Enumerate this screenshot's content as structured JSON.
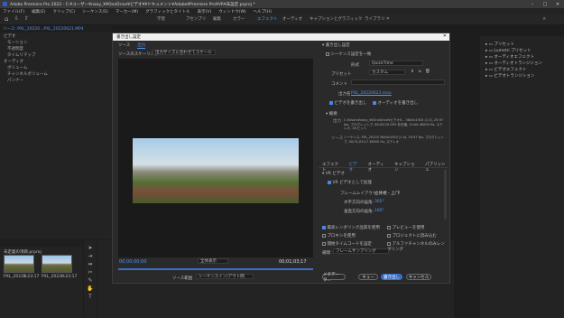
{
  "window": {
    "title": "Adobe Premiere Pro 2022 - C:¥ユーザー¥naoy_¥¥OneDrive¥ビデオ¥¥ドキュメント¥Adobe¥Premiere Pro¥VR¥未設定.prproj *"
  },
  "menu": [
    "ファイル(F)",
    "編集(E)",
    "クリップ(C)",
    "シーケンス(S)",
    "マーカー(M)",
    "グラフィックとタイトル",
    "表示(V)",
    "ウィンドウ(W)",
    "ヘルプ(H)"
  ],
  "workspaces": {
    "items": [
      {
        "label": "学習"
      },
      {
        "label": "アセンブリ"
      },
      {
        "label": "編集"
      },
      {
        "label": "カラー"
      },
      {
        "label": "エフェクト",
        "active": true
      },
      {
        "label": "オーディオ"
      },
      {
        "label": "キャプションとグラフィック"
      },
      {
        "label": "ライブラリ"
      }
    ]
  },
  "effect_controls": {
    "tab": "ソース: PXL_20220...PXL_20220621.MP4",
    "header": "ビデオ",
    "rows": [
      "モーション",
      "不透明度",
      "タイムリマップ",
      "オーディオ",
      "ボリューム",
      "チャンネルボリューム",
      "パンナー"
    ]
  },
  "project": {
    "title": "未定義の項目.prproj",
    "items": [
      {
        "name": "PXL_20220...",
        "duration": "1:23:17"
      },
      {
        "name": "PXL_20220...",
        "duration": "0:23:17"
      }
    ]
  },
  "effects_panel": {
    "items": [
      "プリセット",
      "Lumetri プリセット",
      "オーディオエフェクト",
      "オーディオトランジション",
      "ビデオエフェクト",
      "ビデオトランジション"
    ]
  },
  "dialog": {
    "title": "書き出し設定",
    "tabs": [
      {
        "label": "ソース"
      },
      {
        "label": "出力",
        "active": true
      }
    ],
    "scaling_label": "ソースのスケーリング",
    "scaling_value": "出力サイズに合わせてスケール",
    "timecode_in": "00;00;00;00",
    "fit_label": "全体表示",
    "timecode_out": "00;01;03;17",
    "range_label": "ソース範囲",
    "range_value": "シーケンスイン/アウト間",
    "export_settings": {
      "section": "書き出し設定",
      "match_sequence": "シーケンス設定を一致",
      "format_label": "形式",
      "format_value": "QuickTime",
      "preset_label": "プリセット",
      "preset_value": "カスタム",
      "comment_label": "コメント",
      "output_name_label": "出力名",
      "output_name_value": "PXL_20220621.mov",
      "export_video": "ビデオを書き出し",
      "export_audio": "オーディオを書き出し"
    },
    "summary": {
      "label": "概要",
      "output_label": "出力",
      "output_text": "C:¥Users¥naoy_¥¥OneDrive¥ビデオ¥... 3840x1920 (1.0), 29.97 fps, プログレッシブ, 60:00:00 GPU 非圧縮, 10-bit 48000 Hz, ステレオ, 16 ビット",
      "source_label": "ソース",
      "source_text": "シーケンス, PXL_20220 3840x1920 (1.0), 29.97 fps, プログレッシブ, 00;01;03;17 48000 Hz, ステレオ"
    },
    "subtabs": [
      {
        "label": "エフェクト"
      },
      {
        "label": "ビデオ",
        "active": true
      },
      {
        "label": "オーディオ"
      },
      {
        "label": "キャプション"
      },
      {
        "label": "パブリッシュ"
      }
    ],
    "vr": {
      "section": "VR ビデオ",
      "is_vr": "VR ビデオとして処理",
      "frame_layout_label": "フレームレイアウト:",
      "frame_layout_value": "立体視 - 上/下",
      "h_view_label": "水平方向の画角:",
      "h_view_value": "360°",
      "v_view_label": "垂直方向の画角:",
      "v_view_value": "180°"
    },
    "options": {
      "max_render": "最高レンダリング品質を使用",
      "preview": "プレビューを使用",
      "proxy": "プロキシを使用",
      "start_tc": "開始タイムコードを設定",
      "interp_label": "補間",
      "interp_value": "フレームサンプリング",
      "import_project": "プロジェクトに読み込む",
      "alpha": "アルファチャンネルのみレンダリング"
    },
    "buttons": {
      "metadata": "メタデータ...",
      "queue": "キュー",
      "export": "書き出し",
      "cancel": "キャンセル"
    }
  },
  "colors": {
    "accent": "#4f94ef",
    "panel": "#232323",
    "dialog": "#2a2a2a"
  }
}
